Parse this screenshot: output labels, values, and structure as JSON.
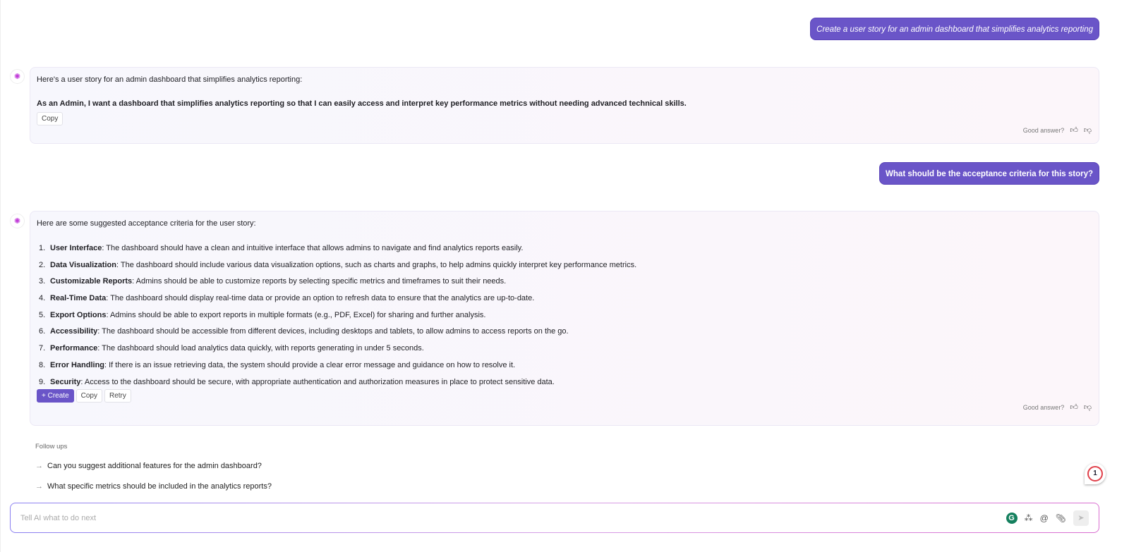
{
  "conversation": {
    "user_messages": [
      "Create a user story for an admin dashboard that simplifies analytics reporting",
      "What should be the acceptance criteria for this story?"
    ],
    "reply1": {
      "intro": "Here's a user story for an admin dashboard that simplifies analytics reporting:",
      "story": "As an Admin, I want a dashboard that simplifies analytics reporting so that I can easily access and interpret key performance metrics without needing advanced technical skills.",
      "copy_label": "Copy",
      "feedback_label": "Good answer?"
    },
    "reply2": {
      "intro": "Here are some suggested acceptance criteria for the user story:",
      "criteria": [
        {
          "num": "1.",
          "title": "User Interface",
          "text": ": The dashboard should have a clean and intuitive interface that allows admins to navigate and find analytics reports easily."
        },
        {
          "num": "2.",
          "title": "Data Visualization",
          "text": ": The dashboard should include various data visualization options, such as charts and graphs, to help admins quickly interpret key performance metrics."
        },
        {
          "num": "3.",
          "title": "Customizable Reports",
          "text": ": Admins should be able to customize reports by selecting specific metrics and timeframes to suit their needs."
        },
        {
          "num": "4.",
          "title": "Real-Time Data",
          "text": ": The dashboard should display real-time data or provide an option to refresh data to ensure that the analytics are up-to-date."
        },
        {
          "num": "5.",
          "title": "Export Options",
          "text": ": Admins should be able to export reports in multiple formats (e.g., PDF, Excel) for sharing and further analysis."
        },
        {
          "num": "6.",
          "title": "Accessibility",
          "text": ": The dashboard should be accessible from different devices, including desktops and tablets, to allow admins to access reports on the go."
        },
        {
          "num": "7.",
          "title": "Performance",
          "text": ": The dashboard should load analytics data quickly, with reports generating in under 5 seconds."
        },
        {
          "num": "8.",
          "title": "Error Handling",
          "text": ": If there is an issue retrieving data, the system should provide a clear error message and guidance on how to resolve it."
        },
        {
          "num": "9.",
          "title": "Security",
          "text": ": Access to the dashboard should be secure, with appropriate authentication and authorization measures in place to protect sensitive data."
        }
      ],
      "create_label": "+ Create",
      "copy_label": "Copy",
      "retry_label": "Retry",
      "feedback_label": "Good answer?"
    }
  },
  "followups": {
    "label": "Follow ups",
    "items": [
      "Can you suggest additional features for the admin dashboard?",
      "What specific metrics should be included in the analytics reports?"
    ]
  },
  "composer": {
    "placeholder": "Tell AI what to do next",
    "value": ""
  },
  "notification_badge": "1",
  "colors": {
    "accent": "#6a55c8",
    "grammarly": "#15805e",
    "badge_ring": "#e0404a"
  }
}
